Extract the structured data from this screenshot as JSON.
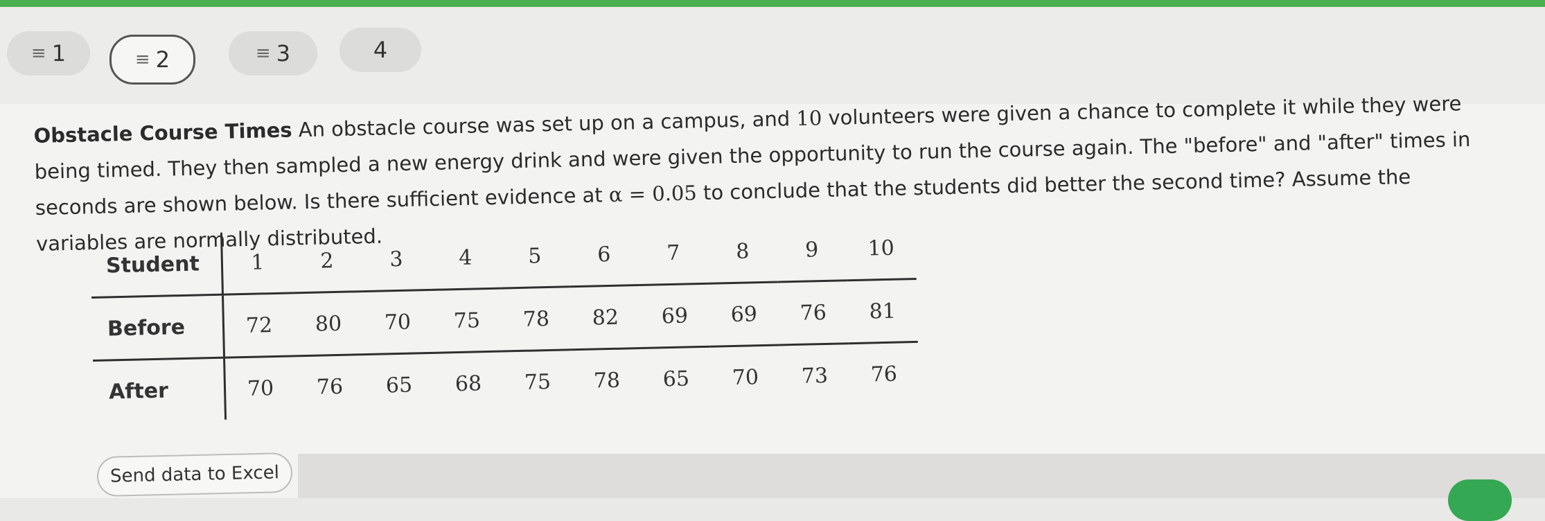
{
  "steps": [
    {
      "label": "1",
      "icon": "lines-icon",
      "active": false
    },
    {
      "label": "2",
      "icon": "lines-icon",
      "active": true
    },
    {
      "label": "3",
      "icon": "lines-icon",
      "active": false
    },
    {
      "label": "4",
      "icon": "",
      "active": false
    }
  ],
  "step_icon_glyph": "≡",
  "problem": {
    "title": "Obstacle Course Times",
    "text_1": " An obstacle course was set up on a campus, and ",
    "volunteers": "10",
    "text_2": " volunteers were given a chance to complete it while they were being timed. They then sampled a new energy drink and were given the opportunity to run the course again. The \"before\" and \"after\" times in seconds are shown below. Is there sufficient evidence at ",
    "alpha": "α = 0.05",
    "text_3": " to conclude that the students did better the second time? Assume the variables are normally distributed."
  },
  "table": {
    "rows": [
      {
        "label": "Student",
        "values": [
          "1",
          "2",
          "3",
          "4",
          "5",
          "6",
          "7",
          "8",
          "9",
          "10"
        ]
      },
      {
        "label": "Before",
        "values": [
          "72",
          "80",
          "70",
          "75",
          "78",
          "82",
          "69",
          "69",
          "76",
          "81"
        ]
      },
      {
        "label": "After",
        "values": [
          "70",
          "76",
          "65",
          "68",
          "75",
          "78",
          "65",
          "70",
          "73",
          "76"
        ]
      }
    ]
  },
  "excel_button": {
    "label": "Send data to Excel"
  },
  "colors": {
    "accent": "#4caf50",
    "active_border": "#555555",
    "green_button": "#34a853"
  }
}
